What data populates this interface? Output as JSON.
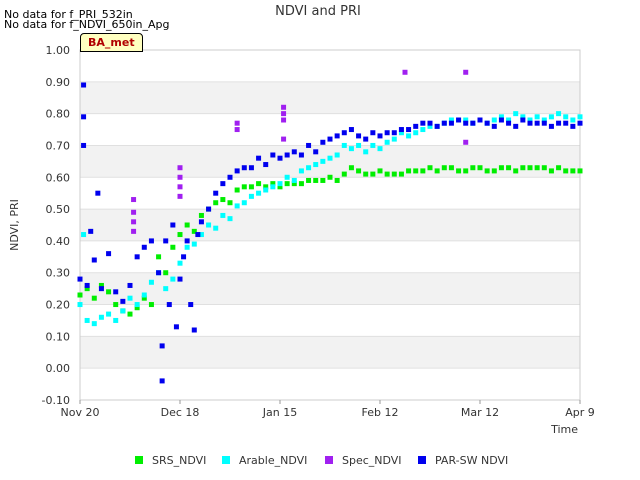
{
  "messages": [
    "No data for f_PRI_532in",
    "No data for f_NDVI_650in_Apg"
  ],
  "site_tag": "BA_met",
  "chart_data": {
    "type": "scatter",
    "title": "NDVI and PRI",
    "xlabel": "Time",
    "ylabel": "NDVI, PRI",
    "x_start": "2023-11-20",
    "xlim_days": [
      0,
      140
    ],
    "ylim": [
      -0.1,
      1.0
    ],
    "yticks": [
      "-0.10",
      "0.00",
      "0.10",
      "0.20",
      "0.30",
      "0.40",
      "0.50",
      "0.60",
      "0.70",
      "0.80",
      "0.90",
      "1.00"
    ],
    "xticks": [
      {
        "day": 0,
        "label": "Nov 20"
      },
      {
        "day": 28,
        "label": "Dec 18"
      },
      {
        "day": 56,
        "label": "Jan 15"
      },
      {
        "day": 84,
        "label": "Feb 12"
      },
      {
        "day": 112,
        "label": "Mar 12"
      },
      {
        "day": 140,
        "label": "Apr 9"
      }
    ],
    "grid": true,
    "legend_position": "bottom",
    "series": [
      {
        "name": "SRS_NDVI",
        "color": "#00ee00",
        "points": [
          [
            0,
            0.23
          ],
          [
            2,
            0.25
          ],
          [
            4,
            0.22
          ],
          [
            6,
            0.26
          ],
          [
            8,
            0.24
          ],
          [
            10,
            0.2
          ],
          [
            12,
            0.18
          ],
          [
            14,
            0.17
          ],
          [
            16,
            0.19
          ],
          [
            18,
            0.22
          ],
          [
            20,
            0.2
          ],
          [
            22,
            0.35
          ],
          [
            24,
            0.3
          ],
          [
            26,
            0.38
          ],
          [
            28,
            0.42
          ],
          [
            30,
            0.45
          ],
          [
            32,
            0.43
          ],
          [
            34,
            0.48
          ],
          [
            36,
            0.5
          ],
          [
            38,
            0.52
          ],
          [
            40,
            0.53
          ],
          [
            42,
            0.52
          ],
          [
            44,
            0.56
          ],
          [
            46,
            0.57
          ],
          [
            48,
            0.57
          ],
          [
            50,
            0.58
          ],
          [
            52,
            0.57
          ],
          [
            54,
            0.58
          ],
          [
            56,
            0.57
          ],
          [
            58,
            0.58
          ],
          [
            60,
            0.58
          ],
          [
            62,
            0.58
          ],
          [
            64,
            0.59
          ],
          [
            66,
            0.59
          ],
          [
            68,
            0.59
          ],
          [
            70,
            0.6
          ],
          [
            72,
            0.59
          ],
          [
            74,
            0.61
          ],
          [
            76,
            0.63
          ],
          [
            78,
            0.62
          ],
          [
            80,
            0.61
          ],
          [
            82,
            0.61
          ],
          [
            84,
            0.62
          ],
          [
            86,
            0.61
          ],
          [
            88,
            0.61
          ],
          [
            90,
            0.61
          ],
          [
            92,
            0.62
          ],
          [
            94,
            0.62
          ],
          [
            96,
            0.62
          ],
          [
            98,
            0.63
          ],
          [
            100,
            0.62
          ],
          [
            102,
            0.63
          ],
          [
            104,
            0.63
          ],
          [
            106,
            0.62
          ],
          [
            108,
            0.62
          ],
          [
            110,
            0.63
          ],
          [
            112,
            0.63
          ],
          [
            114,
            0.62
          ],
          [
            116,
            0.62
          ],
          [
            118,
            0.63
          ],
          [
            120,
            0.63
          ],
          [
            122,
            0.62
          ],
          [
            124,
            0.63
          ],
          [
            126,
            0.63
          ],
          [
            128,
            0.63
          ],
          [
            130,
            0.63
          ],
          [
            132,
            0.62
          ],
          [
            134,
            0.63
          ],
          [
            136,
            0.62
          ],
          [
            138,
            0.62
          ],
          [
            140,
            0.62
          ]
        ]
      },
      {
        "name": "Arable_NDVI",
        "color": "#00ffff",
        "points": [
          [
            0,
            0.2
          ],
          [
            1,
            0.42
          ],
          [
            2,
            0.15
          ],
          [
            4,
            0.14
          ],
          [
            6,
            0.16
          ],
          [
            8,
            0.17
          ],
          [
            10,
            0.15
          ],
          [
            12,
            0.18
          ],
          [
            14,
            0.22
          ],
          [
            16,
            0.2
          ],
          [
            18,
            0.23
          ],
          [
            20,
            0.27
          ],
          [
            22,
            0.3
          ],
          [
            24,
            0.25
          ],
          [
            26,
            0.28
          ],
          [
            28,
            0.33
          ],
          [
            30,
            0.38
          ],
          [
            32,
            0.39
          ],
          [
            34,
            0.42
          ],
          [
            36,
            0.45
          ],
          [
            38,
            0.44
          ],
          [
            40,
            0.48
          ],
          [
            42,
            0.47
          ],
          [
            44,
            0.51
          ],
          [
            46,
            0.52
          ],
          [
            48,
            0.54
          ],
          [
            50,
            0.55
          ],
          [
            52,
            0.56
          ],
          [
            54,
            0.57
          ],
          [
            56,
            0.58
          ],
          [
            58,
            0.6
          ],
          [
            60,
            0.59
          ],
          [
            62,
            0.62
          ],
          [
            64,
            0.63
          ],
          [
            66,
            0.64
          ],
          [
            68,
            0.65
          ],
          [
            70,
            0.66
          ],
          [
            72,
            0.67
          ],
          [
            74,
            0.7
          ],
          [
            76,
            0.69
          ],
          [
            78,
            0.7
          ],
          [
            80,
            0.68
          ],
          [
            82,
            0.7
          ],
          [
            84,
            0.69
          ],
          [
            86,
            0.71
          ],
          [
            88,
            0.72
          ],
          [
            90,
            0.74
          ],
          [
            92,
            0.73
          ],
          [
            94,
            0.74
          ],
          [
            96,
            0.75
          ],
          [
            98,
            0.76
          ],
          [
            100,
            0.76
          ],
          [
            102,
            0.77
          ],
          [
            104,
            0.78
          ],
          [
            106,
            0.78
          ],
          [
            108,
            0.78
          ],
          [
            110,
            0.77
          ],
          [
            112,
            0.78
          ],
          [
            114,
            0.77
          ],
          [
            116,
            0.78
          ],
          [
            118,
            0.79
          ],
          [
            120,
            0.78
          ],
          [
            122,
            0.8
          ],
          [
            124,
            0.79
          ],
          [
            126,
            0.78
          ],
          [
            128,
            0.79
          ],
          [
            130,
            0.78
          ],
          [
            132,
            0.79
          ],
          [
            134,
            0.8
          ],
          [
            136,
            0.79
          ],
          [
            138,
            0.78
          ],
          [
            140,
            0.79
          ]
        ]
      },
      {
        "name": "Spec_NDVI",
        "color": "#a020f0",
        "points": [
          [
            15,
            0.53
          ],
          [
            15,
            0.49
          ],
          [
            15,
            0.46
          ],
          [
            15,
            0.43
          ],
          [
            28,
            0.63
          ],
          [
            28,
            0.6
          ],
          [
            28,
            0.57
          ],
          [
            28,
            0.54
          ],
          [
            44,
            0.77
          ],
          [
            44,
            0.75
          ],
          [
            57,
            0.82
          ],
          [
            57,
            0.8
          ],
          [
            57,
            0.78
          ],
          [
            57,
            0.72
          ],
          [
            91,
            0.93
          ],
          [
            108,
            0.93
          ],
          [
            108,
            0.71
          ]
        ]
      },
      {
        "name": "PAR-SW NDVI",
        "color": "#0000ee",
        "points": [
          [
            0,
            0.28
          ],
          [
            1,
            0.89
          ],
          [
            1,
            0.79
          ],
          [
            1,
            0.7
          ],
          [
            2,
            0.26
          ],
          [
            3,
            0.43
          ],
          [
            4,
            0.34
          ],
          [
            5,
            0.55
          ],
          [
            6,
            0.25
          ],
          [
            8,
            0.36
          ],
          [
            10,
            0.24
          ],
          [
            12,
            0.21
          ],
          [
            14,
            0.26
          ],
          [
            16,
            0.35
          ],
          [
            18,
            0.38
          ],
          [
            20,
            0.4
          ],
          [
            22,
            0.3
          ],
          [
            23,
            0.07
          ],
          [
            23,
            -0.04
          ],
          [
            24,
            0.4
          ],
          [
            25,
            0.2
          ],
          [
            26,
            0.45
          ],
          [
            27,
            0.13
          ],
          [
            28,
            0.28
          ],
          [
            29,
            0.35
          ],
          [
            30,
            0.4
          ],
          [
            31,
            0.2
          ],
          [
            32,
            0.12
          ],
          [
            33,
            0.42
          ],
          [
            34,
            0.46
          ],
          [
            36,
            0.5
          ],
          [
            38,
            0.55
          ],
          [
            40,
            0.58
          ],
          [
            42,
            0.6
          ],
          [
            44,
            0.62
          ],
          [
            46,
            0.63
          ],
          [
            48,
            0.63
          ],
          [
            50,
            0.66
          ],
          [
            52,
            0.64
          ],
          [
            54,
            0.67
          ],
          [
            56,
            0.66
          ],
          [
            58,
            0.67
          ],
          [
            60,
            0.68
          ],
          [
            62,
            0.67
          ],
          [
            64,
            0.7
          ],
          [
            66,
            0.68
          ],
          [
            68,
            0.71
          ],
          [
            70,
            0.72
          ],
          [
            72,
            0.73
          ],
          [
            74,
            0.74
          ],
          [
            76,
            0.75
          ],
          [
            78,
            0.73
          ],
          [
            80,
            0.72
          ],
          [
            82,
            0.74
          ],
          [
            84,
            0.73
          ],
          [
            86,
            0.74
          ],
          [
            88,
            0.74
          ],
          [
            90,
            0.75
          ],
          [
            92,
            0.75
          ],
          [
            94,
            0.76
          ],
          [
            96,
            0.77
          ],
          [
            98,
            0.77
          ],
          [
            100,
            0.76
          ],
          [
            102,
            0.77
          ],
          [
            104,
            0.77
          ],
          [
            106,
            0.78
          ],
          [
            108,
            0.77
          ],
          [
            110,
            0.77
          ],
          [
            112,
            0.78
          ],
          [
            114,
            0.77
          ],
          [
            116,
            0.76
          ],
          [
            118,
            0.78
          ],
          [
            120,
            0.77
          ],
          [
            122,
            0.76
          ],
          [
            124,
            0.78
          ],
          [
            126,
            0.77
          ],
          [
            128,
            0.77
          ],
          [
            130,
            0.77
          ],
          [
            132,
            0.76
          ],
          [
            134,
            0.77
          ],
          [
            136,
            0.77
          ],
          [
            138,
            0.76
          ],
          [
            140,
            0.77
          ]
        ]
      }
    ]
  }
}
